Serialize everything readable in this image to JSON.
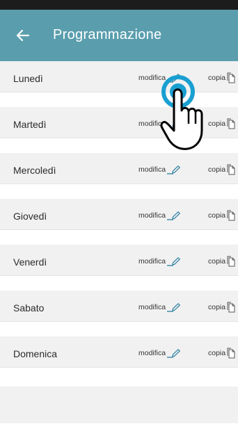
{
  "header": {
    "title": "Programmazione",
    "back_icon": "back-arrow-icon",
    "bg_color": "#5a9eae"
  },
  "days": [
    {
      "label": "Lunedì",
      "edit_label": "modifica",
      "copy_label": "copia"
    },
    {
      "label": "Martedì",
      "edit_label": "modifica",
      "copy_label": "copia"
    },
    {
      "label": "Mercoledì",
      "edit_label": "modifica",
      "copy_label": "copia"
    },
    {
      "label": "Giovedì",
      "edit_label": "modifica",
      "copy_label": "copia"
    },
    {
      "label": "Venerdì",
      "edit_label": "modifica",
      "copy_label": "copia"
    },
    {
      "label": "Sabato",
      "edit_label": "modifica",
      "copy_label": "copia"
    },
    {
      "label": "Domenica",
      "edit_label": "modifica",
      "copy_label": "copia"
    }
  ],
  "icons": {
    "edit": "pencil-icon",
    "copy": "copy-document-icon",
    "pointer": "hand-pointer-icon"
  },
  "colors": {
    "accent": "#5a9eae",
    "pencil": "#3a87a6",
    "row_bg": "#f1f1f1"
  }
}
